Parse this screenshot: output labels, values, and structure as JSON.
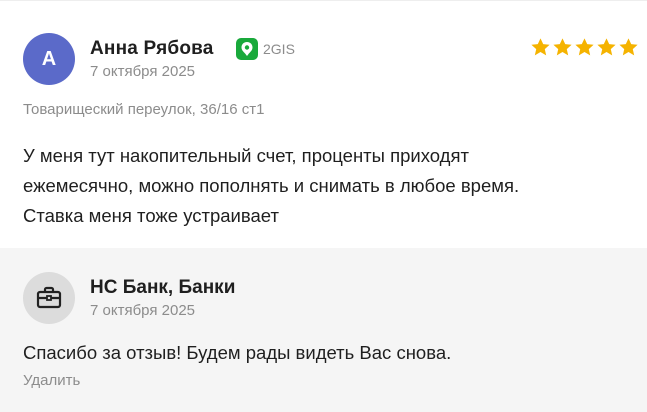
{
  "review": {
    "avatar_letter": "А",
    "avatar_color": "#5b6ac9",
    "author": "Анна Рябова",
    "source": {
      "icon": "2gis-logo-icon",
      "label": "2GIS",
      "color": "#19a93b"
    },
    "date": "7 октября 2025",
    "rating": 5,
    "rating_max": 5,
    "star_color": "#f5b300",
    "address": "Товарищеский переулок, 36/16 ст1",
    "text": "У меня тут накопительный счет, проценты приходят\nежемесячно, можно пополнять и снимать в любое время.\nСтавка меня тоже устраивает"
  },
  "reply": {
    "avatar_icon": "briefcase-icon",
    "author": "НС Банк, Банки",
    "date": "7 октября 2025",
    "text": "Спасибо за отзыв! Будем рады видеть Вас снова.",
    "delete_label": "Удалить"
  }
}
